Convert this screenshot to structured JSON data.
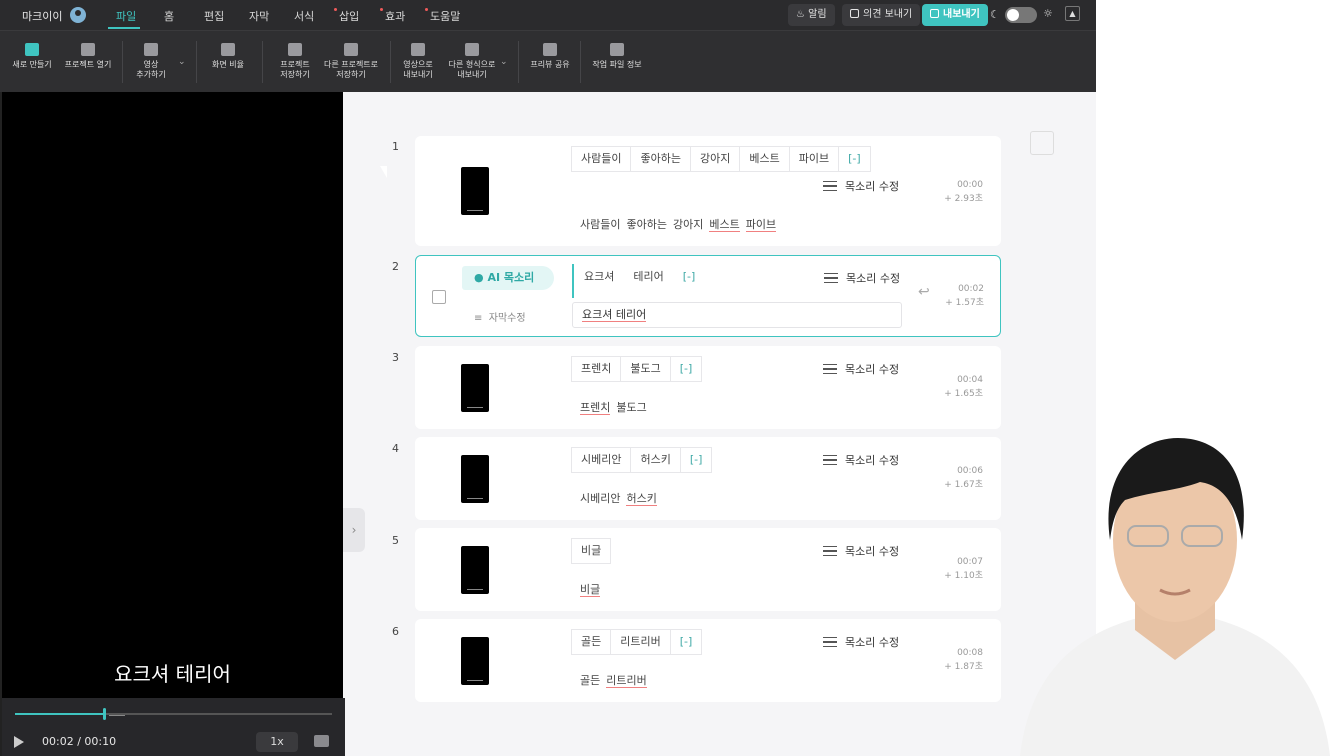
{
  "menu": {
    "brand": "마크이이",
    "items": [
      {
        "label": "파일",
        "active": true
      },
      {
        "label": "홈"
      },
      {
        "label": "편집"
      },
      {
        "label": "자막"
      },
      {
        "label": "서식"
      },
      {
        "label": "삽입",
        "dot": true
      },
      {
        "label": "효과",
        "dot": true
      },
      {
        "label": "도움말",
        "dot": true
      }
    ],
    "alarm_label": "알림",
    "feedback_label": "의견 보내기",
    "export_label": "내보내기"
  },
  "toolbar": {
    "new_label": "새로 만들기",
    "open_label": "프로젝트 열기",
    "add_video_label": "영상\n추가하기",
    "ratio_label": "화면 비율",
    "save_label": "프로젝트\n저장하기",
    "save_as_label": "다른 프로젝트로\n저장하기",
    "export_video_label": "영상으로\n내보내기",
    "export_other_label": "다른 형식으로\n내보내기",
    "preview_share_label": "프리뷰 공유",
    "file_info_label": "작업 파일 정보"
  },
  "player": {
    "subtitle": "요크셔 테리어",
    "time": "00:02 / 00:10",
    "progress": 0.28,
    "speed": "1x"
  },
  "scenes": [
    {
      "num": "1",
      "words": [
        "사람들이",
        "좋아하는",
        "강아지",
        "베스트",
        "파이브"
      ],
      "bracket": "[-]",
      "voice": "목소리 수정",
      "start": "00:00",
      "dur": "+ 2.93초",
      "sub": [
        "사람들이",
        "좋아하는",
        "강아지",
        "베스트",
        "파이브"
      ]
    },
    {
      "num": "2",
      "ai_label": "AI 목소리",
      "edit_label": "자막수정",
      "words": [
        "요크셔",
        "테리어"
      ],
      "bracket": "[-]",
      "voice": "목소리 수정",
      "start": "00:02",
      "dur": "+ 1.57초",
      "sub_text": "요크셔 테리어"
    },
    {
      "num": "3",
      "words": [
        "프렌치",
        "불도그"
      ],
      "bracket": "[-]",
      "voice": "목소리 수정",
      "start": "00:04",
      "dur": "+ 1.65초",
      "sub": [
        "프렌치",
        "불도그"
      ]
    },
    {
      "num": "4",
      "words": [
        "시베리안",
        "허스키"
      ],
      "bracket": "[-]",
      "voice": "목소리 수정",
      "start": "00:06",
      "dur": "+ 1.67초",
      "sub": [
        "시베리안",
        "허스키"
      ]
    },
    {
      "num": "5",
      "words": [
        "비글"
      ],
      "voice": "목소리 수정",
      "start": "00:07",
      "dur": "+ 1.10초",
      "sub": [
        "비글"
      ]
    },
    {
      "num": "6",
      "words": [
        "골든",
        "리트리버"
      ],
      "bracket": "[-]",
      "voice": "목소리 수정",
      "start": "00:08",
      "dur": "+ 1.87초",
      "sub": [
        "골든",
        "리트리버"
      ]
    }
  ],
  "colors": {
    "accent": "#3fc4c0",
    "dark": "#2b2b2d"
  }
}
